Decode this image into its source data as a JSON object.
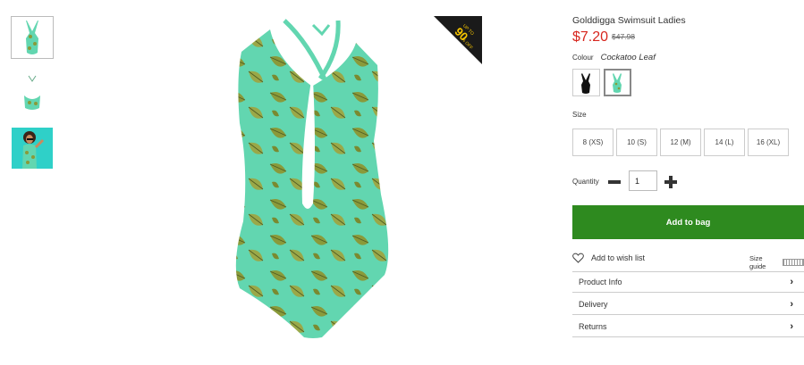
{
  "product": {
    "title": "Golddigga Swimsuit Ladies",
    "price": "$7.20",
    "was_price": "$47.98",
    "badge_line1": "UP TO",
    "badge_line2": "90",
    "badge_line3": "% OFF"
  },
  "colour": {
    "label": "Colour",
    "value": "Cockatoo Leaf",
    "swatches": [
      "black-swimsuit",
      "cockatoo-leaf-swimsuit"
    ]
  },
  "size": {
    "label": "Size",
    "options": [
      "8 (XS)",
      "10 (S)",
      "12 (M)",
      "14 (L)",
      "16 (XL)"
    ]
  },
  "quantity": {
    "label": "Quantity",
    "value": "1"
  },
  "actions": {
    "add_to_bag": "Add to bag",
    "wish_list": "Add to wish list",
    "size_guide": "Size guide"
  },
  "accordion": [
    "Product Info",
    "Delivery",
    "Returns"
  ],
  "colors": {
    "accent_green": "#2e8a1f",
    "price_red": "#d7261e",
    "swimsuit_base": "#62d6b0",
    "leaf": "#8a9a3a"
  }
}
